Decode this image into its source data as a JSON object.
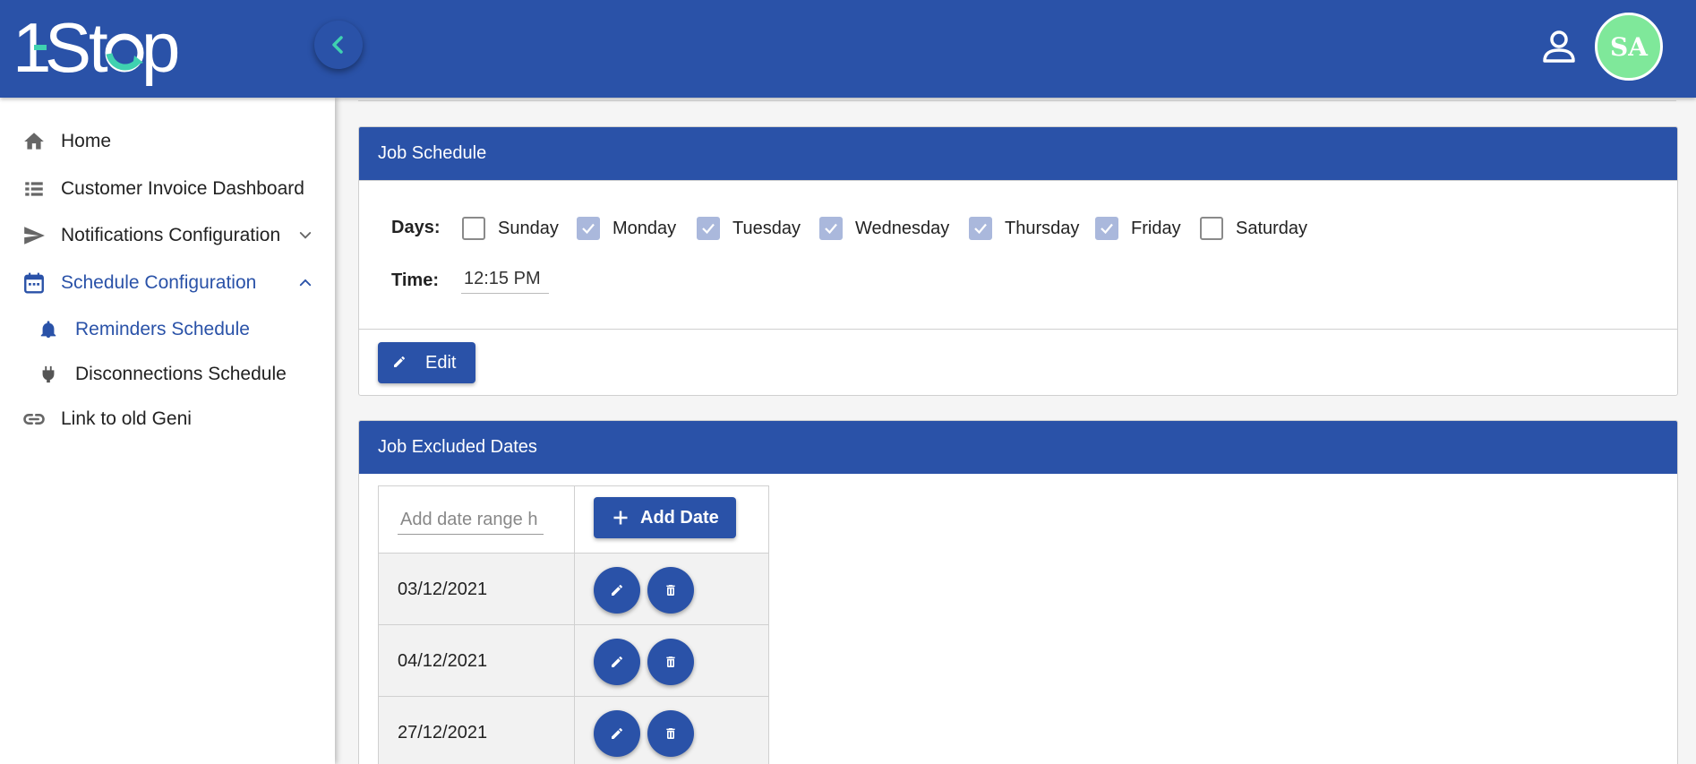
{
  "app": {
    "logo_text": "1-Stop",
    "avatar_initials": "SA",
    "colors": {
      "primary": "#2a52a8",
      "accent": "#3fd1b0",
      "avatar": "#7fe89a",
      "checkbox_checked": "#aab8dc"
    }
  },
  "sidebar": {
    "items": [
      {
        "label": "Home",
        "icon": "home-icon"
      },
      {
        "label": "Customer Invoice Dashboard",
        "icon": "list-icon"
      },
      {
        "label": "Notifications Configuration",
        "icon": "send-icon",
        "expand": "chevron-down-icon"
      },
      {
        "label": "Schedule Configuration",
        "icon": "calendar-icon",
        "expand": "chevron-up-icon",
        "active": true
      },
      {
        "label": "Reminders Schedule",
        "icon": "bell-icon",
        "active": true,
        "sub": true
      },
      {
        "label": "Disconnections Schedule",
        "icon": "plug-icon",
        "sub": true
      },
      {
        "label": "Link to old Geni",
        "icon": "link-icon"
      }
    ]
  },
  "job_schedule": {
    "title": "Job Schedule",
    "days_label": "Days:",
    "days": [
      {
        "label": "Sunday",
        "checked": false
      },
      {
        "label": "Monday",
        "checked": true
      },
      {
        "label": "Tuesday",
        "checked": true
      },
      {
        "label": "Wednesday",
        "checked": true
      },
      {
        "label": "Thursday",
        "checked": true
      },
      {
        "label": "Friday",
        "checked": true
      },
      {
        "label": "Saturday",
        "checked": false
      }
    ],
    "time_label": "Time:",
    "time_value": "12:15 PM",
    "edit_label": "Edit"
  },
  "job_excluded_dates": {
    "title": "Job Excluded Dates",
    "input_placeholder": "Add date range h",
    "add_label": "Add Date",
    "dates": [
      "03/12/2021",
      "04/12/2021",
      "27/12/2021"
    ]
  }
}
